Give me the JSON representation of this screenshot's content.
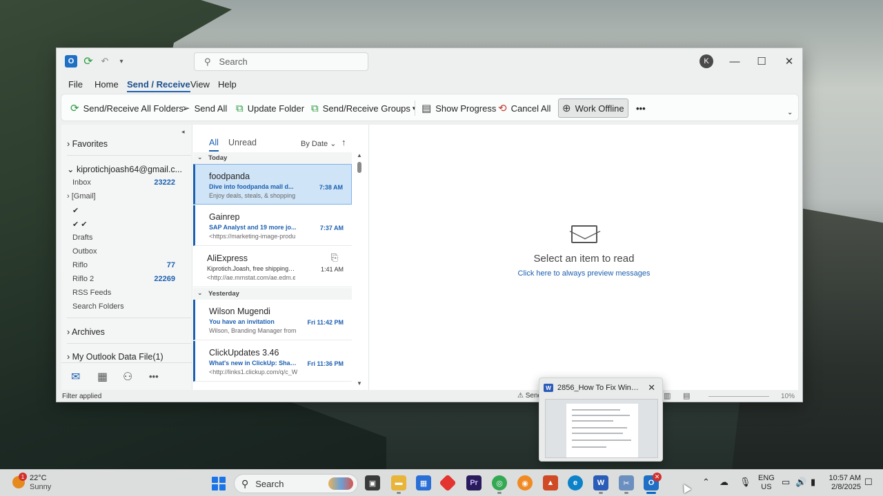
{
  "window": {
    "search_placeholder": "Search",
    "avatar_initial": "K",
    "minimize": "—",
    "maximize": "☐",
    "close": "✕"
  },
  "menu": {
    "file": "File",
    "home": "Home",
    "send_receive": "Send / Receive",
    "view": "View",
    "help": "Help"
  },
  "ribbon": {
    "send_receive_all": "Send/Receive All Folders",
    "send_all": "Send All",
    "update_folder": "Update Folder",
    "send_receive_groups": "Send/Receive Groups",
    "show_progress": "Show Progress",
    "cancel_all": "Cancel All",
    "work_offline": "Work Offline",
    "more": "•••"
  },
  "folders": {
    "favorites": "Favorites",
    "account": "kiprotichjoash64@gmail.c...",
    "inbox": "Inbox",
    "inbox_count": "23222",
    "gmail": "[Gmail]",
    "check1": "✔",
    "check2": "✔ ✔",
    "drafts": "Drafts",
    "outbox": "Outbox",
    "riflo": "Riflo",
    "riflo_count": "77",
    "riflo2": "Riflo 2",
    "riflo2_count": "22269",
    "rss": "RSS Feeds",
    "search_folders": "Search Folders",
    "archives": "Archives",
    "outlook_data": "My Outlook Data File(1)",
    "more_nav": "•••"
  },
  "list": {
    "tab_all": "All",
    "tab_unread": "Unread",
    "sort": "By Date",
    "group_today": "Today",
    "group_yesterday": "Yesterday",
    "messages": [
      {
        "from": "foodpanda",
        "subject": "Dive into foodpanda mall d...",
        "time": "7:38 AM",
        "preview": "Enjoy deals, steals, & shopping"
      },
      {
        "from": "Gainrep",
        "subject": "SAP Analyst and 19 more jo...",
        "time": "7:37 AM",
        "preview": "<https://marketing-image-produ"
      },
      {
        "from": "AliExpress",
        "subject": "Kiprotich.Joash, free shipping ...",
        "time": "1:41 AM",
        "preview": "<http://ae.mmstat.com/ae.edm.e"
      },
      {
        "from": "Wilson Mugendi",
        "subject": "You have an invitation",
        "time": "Fri 11:42 PM",
        "preview": "Wilson, Branding Manager from"
      },
      {
        "from": "ClickUpdates 3.46",
        "subject": "What's new in ClickUp: Shar...",
        "time": "Fri 11:36 PM",
        "preview": "<http://links1.clickup.com/q/c_W"
      }
    ]
  },
  "reading": {
    "title": "Select an item to read",
    "link": "Click here to always preview messages"
  },
  "status": {
    "filter": "Filter applied",
    "warning": "⚠ Send",
    "zoom": "10%"
  },
  "popup": {
    "title": "2856_How To Fix Windo...",
    "close": "✕",
    "app_letter": "W"
  },
  "taskbar": {
    "badge": "1",
    "temp": "22°C",
    "condition": "Sunny",
    "search": "Search",
    "lang1": "ENG",
    "lang2": "US",
    "time": "10:57 AM",
    "date": "2/8/2025"
  }
}
